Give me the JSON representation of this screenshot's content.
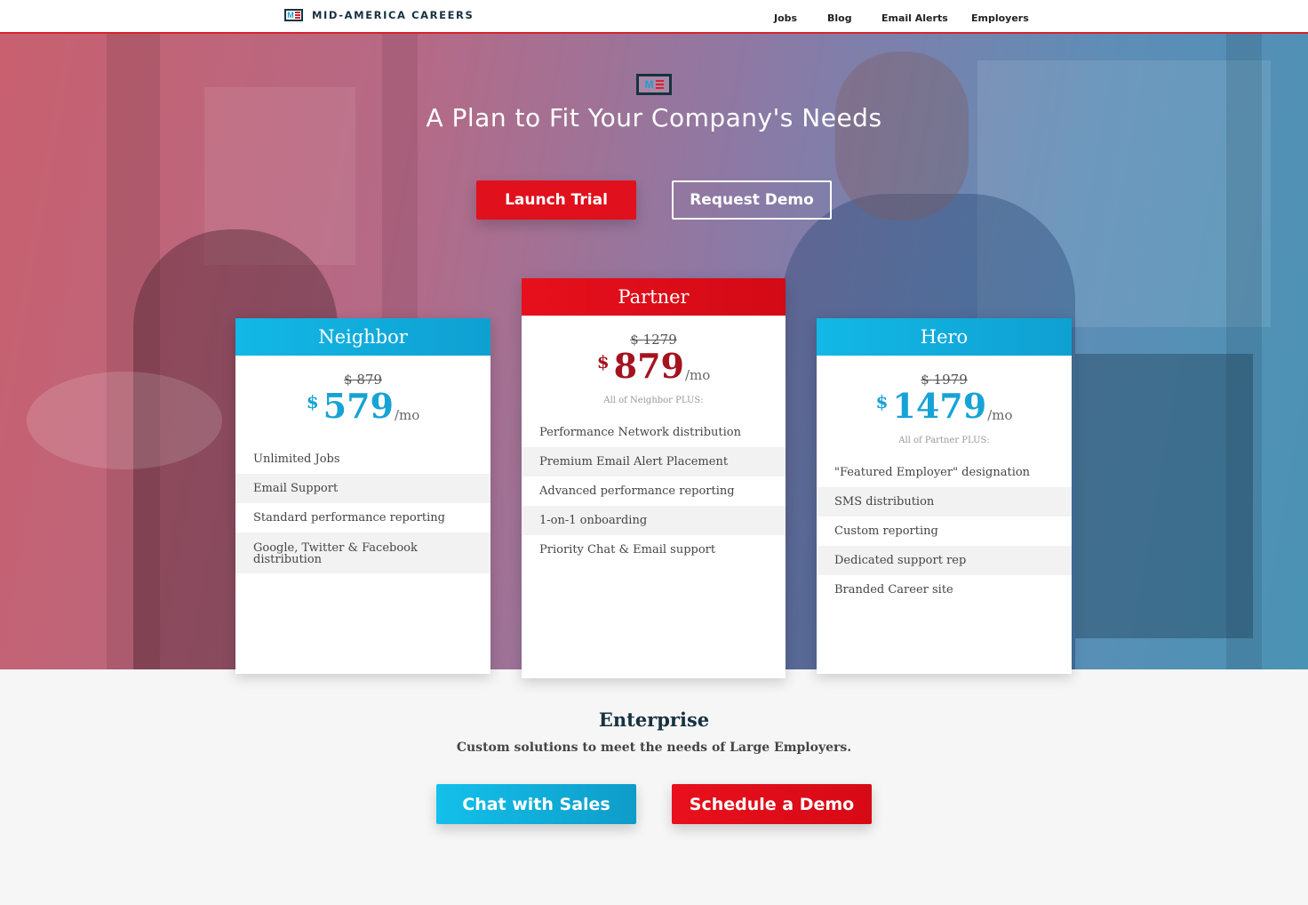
{
  "header": {
    "brand": "MID-AMERICA CAREERS",
    "nav": [
      "Jobs",
      "Blog",
      "Email Alerts",
      "Employers"
    ]
  },
  "hero": {
    "title": "A Plan to Fit Your Company's Needs",
    "launch_label": "Launch Trial",
    "demo_label": "Request Demo"
  },
  "plans": [
    {
      "name": "Neighbor",
      "old_price": "$ 879",
      "currency": "$",
      "price": "579",
      "period": "/mo",
      "features": [
        "Unlimited Jobs",
        "Email Support",
        "Standard performance reporting",
        "Google, Twitter & Facebook distribution"
      ]
    },
    {
      "name": "Partner",
      "old_price": "$ 1279",
      "currency": "$",
      "price": "879",
      "period": "/mo",
      "plus_note": "All of Neighbor PLUS:",
      "features": [
        "Performance Network distribution",
        "Premium Email Alert Placement",
        "Advanced performance reporting",
        "1-on-1 onboarding",
        "Priority Chat & Email support"
      ]
    },
    {
      "name": "Hero",
      "old_price": "$ 1979",
      "currency": "$",
      "price": "1479",
      "period": "/mo",
      "plus_note": "All of Partner PLUS:",
      "features": [
        "\"Featured Employer\" designation",
        "SMS distribution",
        "Custom reporting",
        "Dedicated support rep",
        "Branded Career site"
      ]
    }
  ],
  "enterprise": {
    "title": "Enterprise",
    "subtitle": "Custom solutions to meet the needs of Large Employers.",
    "chat_label": "Chat with Sales",
    "schedule_label": "Schedule a Demo"
  },
  "colors": {
    "accent_red": "#e0101d",
    "accent_blue": "#16a3d6",
    "navy": "#17323f"
  }
}
